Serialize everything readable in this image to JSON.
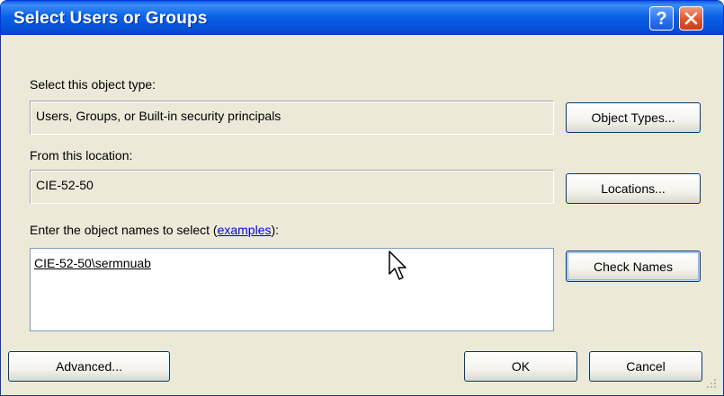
{
  "window": {
    "title": "Select Users or Groups",
    "help_glyph": "?"
  },
  "object_type": {
    "label": "Select this object type:",
    "value": "Users, Groups, or Built-in security principals",
    "button": "Object Types..."
  },
  "location": {
    "label": "From this location:",
    "value": "CIE-52-50",
    "button": "Locations..."
  },
  "names": {
    "label_prefix": "Enter the object names to select (",
    "label_link": "examples",
    "label_suffix": "):",
    "value": "CIE-52-50\\sermnuab",
    "check_button": "Check Names"
  },
  "footer": {
    "advanced": "Advanced...",
    "ok": "OK",
    "cancel": "Cancel"
  },
  "icons": {
    "help": "help-icon",
    "close": "close-icon",
    "cursor": "mouse-pointer-icon",
    "grip": "resize-grip-icon"
  }
}
